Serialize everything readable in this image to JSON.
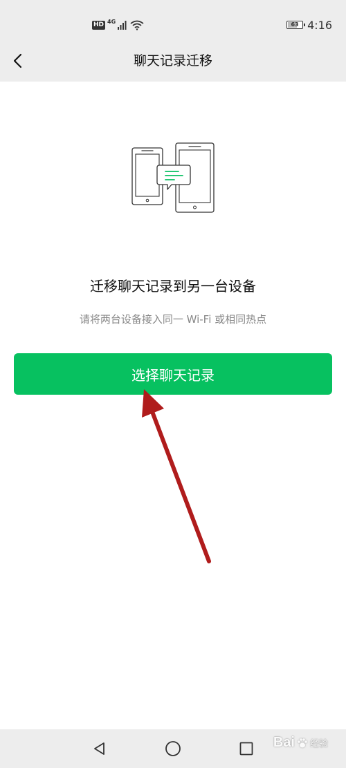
{
  "status_bar": {
    "hd_badge": "HD",
    "network_type": "4G",
    "battery_level": "63",
    "battery_fraction": 0.63,
    "time": "4:16"
  },
  "nav": {
    "title": "聊天记录迁移",
    "back_icon": "chevron-left-icon"
  },
  "main": {
    "illustration_icon": "phone-transfer-icon",
    "heading": "迁移聊天记录到另一台设备",
    "subtext": "请将两台设备接入同一 Wi-Fi 或相同热点",
    "button_label": "选择聊天记录"
  },
  "system_nav": {
    "back_icon": "triangle-back-icon",
    "home_icon": "circle-home-icon",
    "recents_icon": "square-recents-icon"
  },
  "watermark": {
    "text": "Bai",
    "sub": "经验"
  },
  "colors": {
    "accent": "#07c160",
    "background": "#ffffff",
    "bar_background": "#ededed",
    "annotation_arrow": "#b01c1c"
  }
}
